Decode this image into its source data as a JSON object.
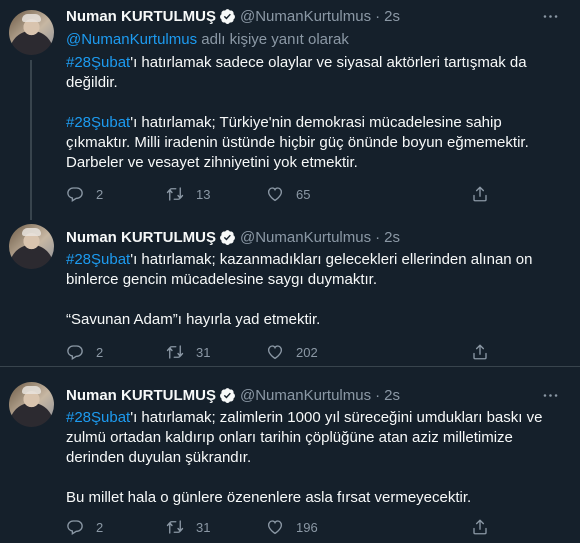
{
  "author": {
    "name": "Numan KURTULMUŞ",
    "handle": "@NumanKurtulmus",
    "time": "2s"
  },
  "separator": "·",
  "colors": {
    "background": "#15202b",
    "link": "#1d9bf0",
    "muted": "#8b98a5",
    "text": "#f7f9f9",
    "divider": "#38444d"
  },
  "tweets": [
    {
      "reply": {
        "mention": "@NumanKurtulmus",
        "suffix": " adlı kişiye yanıt olarak"
      },
      "paragraphs": [
        {
          "hashtag": "#28Şubat",
          "text": "'ı hatırlamak sadece olaylar ve siyasal aktörleri tartışmak da değildir."
        },
        {
          "hashtag": "#28Şubat",
          "text": "'ı hatırlamak; Türkiye'nin demokrasi mücadelesine sahip çıkmaktır. Milli iradenin üstünde hiçbir güç önünde boyun eğmemektir. Darbeler ve vesayet zihniyetini yok etmektir."
        }
      ],
      "stats": {
        "replies": "2",
        "retweets": "13",
        "likes": "65"
      }
    },
    {
      "paragraphs": [
        {
          "hashtag": "#28Şubat",
          "text": "'ı hatırlamak; kazanmadıkları gelecekleri ellerinden alınan on binlerce gencin mücadelesine saygı duymaktır."
        },
        {
          "hashtag": "",
          "text": "“Savunan Adam”ı hayırla yad etmektir."
        }
      ],
      "stats": {
        "replies": "2",
        "retweets": "31",
        "likes": "202"
      }
    },
    {
      "paragraphs": [
        {
          "hashtag": "#28Şubat",
          "text": "'ı hatırlamak; zalimlerin 1000 yıl süreceğini umdukları baskı ve zulmü ortadan kaldırıp onları tarihin çöplüğüne atan aziz milletimize derinden duyulan şükrandır."
        },
        {
          "hashtag": "",
          "text": "Bu millet hala o günlere özenenlere asla fırsat vermeyecektir."
        }
      ],
      "stats": {
        "replies": "2",
        "retweets": "31",
        "likes": "196"
      }
    }
  ],
  "icons": [
    "verified-badge-icon",
    "more-options-icon",
    "reply-icon",
    "retweet-icon",
    "like-icon",
    "share-icon"
  ]
}
